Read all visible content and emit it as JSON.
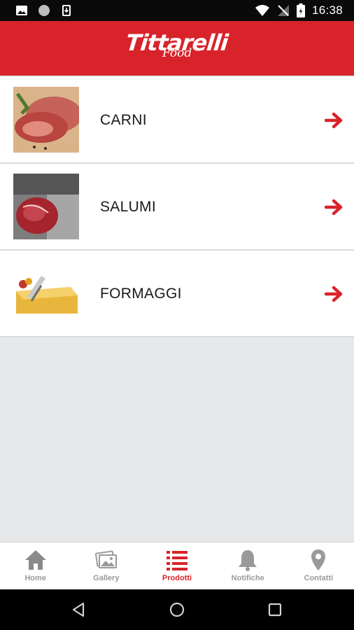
{
  "status_bar": {
    "time": "16:38"
  },
  "header": {
    "brand": "Tittarelli",
    "brand_sub": "Food",
    "accent_color": "#d8232a"
  },
  "categories": [
    {
      "label": "CARNI",
      "image": "meat-photo"
    },
    {
      "label": "SALUMI",
      "image": "cured-meat-photo"
    },
    {
      "label": "FORMAGGI",
      "image": "cheese-photo"
    }
  ],
  "bottom_nav": [
    {
      "label": "Home",
      "icon": "home-icon",
      "active": false
    },
    {
      "label": "Gallery",
      "icon": "gallery-icon",
      "active": false
    },
    {
      "label": "Prodotti",
      "icon": "list-icon",
      "active": true
    },
    {
      "label": "Notifiche",
      "icon": "bell-icon",
      "active": false
    },
    {
      "label": "Contatti",
      "icon": "location-pin-icon",
      "active": false
    }
  ]
}
